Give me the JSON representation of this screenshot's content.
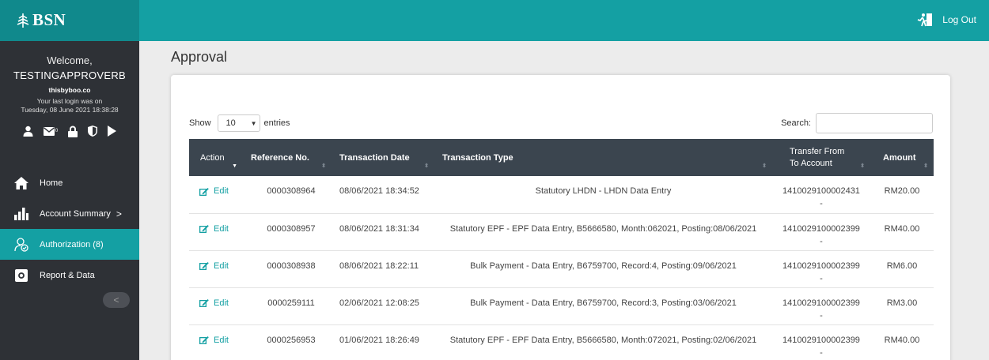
{
  "brand": {
    "name": "BSN"
  },
  "header": {
    "logout_label": "Log Out"
  },
  "sidebar": {
    "welcome": "Welcome,",
    "username": "TESTINGAPPROVERB",
    "company": "thisbyboo.co",
    "last_login_label": "Your last login was on",
    "last_login_time": "Tuesday, 08 June 2021 18:38:28",
    "mail_count": "0",
    "icons": [
      "user-icon",
      "mail-icon",
      "lock-icon",
      "shield-icon",
      "play-icon"
    ],
    "nav": [
      {
        "label": "Home",
        "icon": "home-icon"
      },
      {
        "label": "Account Summary",
        "icon": "bar-chart-icon",
        "chevron": ">"
      },
      {
        "label": "Authorization (8)",
        "icon": "authorization-icon",
        "active": true
      },
      {
        "label": "Report & Data",
        "icon": "report-icon"
      }
    ],
    "collapse_glyph": "<"
  },
  "page": {
    "title": "Approval"
  },
  "table_controls": {
    "show_label": "Show",
    "entries_value": "10",
    "entries_label": "entries",
    "search_label": "Search:",
    "search_value": ""
  },
  "table": {
    "columns": {
      "action": "Action",
      "reference": "Reference No.",
      "date": "Transaction Date",
      "type": "Transaction Type",
      "transfer_line1": "Transfer From",
      "transfer_line2": "To Account",
      "amount": "Amount"
    },
    "edit_label": "Edit",
    "rows": [
      {
        "ref": "0000308964",
        "date": "08/06/2021 18:34:52",
        "type": "Statutory LHDN - LHDN Data Entry",
        "from": "1410029100002431",
        "to": "-",
        "amount": "RM20.00"
      },
      {
        "ref": "0000308957",
        "date": "08/06/2021 18:31:34",
        "type": "Statutory EPF - EPF Data Entry, B5666580, Month:062021, Posting:08/06/2021",
        "from": "1410029100002399",
        "to": "-",
        "amount": "RM40.00"
      },
      {
        "ref": "0000308938",
        "date": "08/06/2021 18:22:11",
        "type": "Bulk Payment - Data Entry, B6759700, Record:4, Posting:09/06/2021",
        "from": "1410029100002399",
        "to": "-",
        "amount": "RM6.00"
      },
      {
        "ref": "0000259111",
        "date": "02/06/2021 12:08:25",
        "type": "Bulk Payment - Data Entry, B6759700, Record:3, Posting:03/06/2021",
        "from": "1410029100002399",
        "to": "-",
        "amount": "RM3.00"
      },
      {
        "ref": "0000256953",
        "date": "01/06/2021 18:26:49",
        "type": "Statutory EPF - EPF Data Entry, B5666580, Month:072021, Posting:02/06/2021",
        "from": "1410029100002399",
        "to": "-",
        "amount": "RM40.00"
      }
    ]
  },
  "colors": {
    "primary": "#14a0a3",
    "sidebar": "#2e3136",
    "table_header": "#3b454f"
  }
}
